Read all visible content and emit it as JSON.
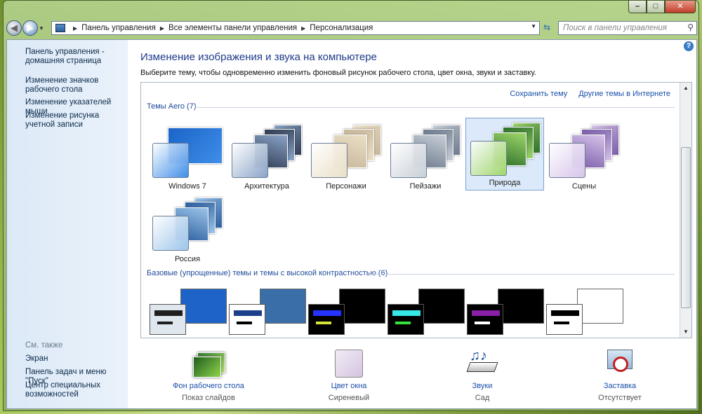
{
  "window": {
    "caption": {
      "minimize": "–",
      "maximize": "□",
      "close": "✕"
    }
  },
  "nav": {
    "back": "◀",
    "forward": "▶",
    "breadcrumbs": [
      "Панель управления",
      "Все элементы панели управления",
      "Персонализация"
    ],
    "search_placeholder": "Поиск в панели управления"
  },
  "sidebar": {
    "links": [
      {
        "label": "Панель управления - домашняя страница"
      },
      {
        "label": "Изменение значков рабочего стола"
      },
      {
        "label": "Изменение указателей мыши"
      },
      {
        "label": "Изменение рисунка учетной записи"
      }
    ],
    "see_also_header": "См. также",
    "see_also": [
      {
        "label": "Экран"
      },
      {
        "label": "Панель задач и меню \"Пуск\""
      },
      {
        "label": "Центр специальных возможностей"
      }
    ]
  },
  "main": {
    "title": "Изменение изображения и звука на компьютере",
    "description": "Выберите тему, чтобы одновременно изменить фоновый рисунок рабочего стола, цвет окна, звуки и заставку.",
    "save_theme": "Сохранить тему",
    "more_themes": "Другие темы в Интернете",
    "aero_group": "Темы Aero (7)",
    "aero_themes": [
      {
        "label": "Windows 7",
        "colors": [
          "#1a64c8",
          "#3f8ee8"
        ]
      },
      {
        "label": "Архитектура",
        "colors": [
          "#2f3c52",
          "#8aa4c8"
        ]
      },
      {
        "label": "Персонажи",
        "colors": [
          "#c7b79a",
          "#eadfc6"
        ]
      },
      {
        "label": "Пейзажи",
        "colors": [
          "#6c7a8c",
          "#c8cfd8"
        ]
      },
      {
        "label": "Природа",
        "colors": [
          "#2c6f2a",
          "#9fd66a"
        ],
        "selected": true
      },
      {
        "label": "Сцены",
        "colors": [
          "#7a5ca8",
          "#d6c4ea"
        ]
      },
      {
        "label": "Россия",
        "colors": [
          "#2b5e9e",
          "#9cc4ea"
        ]
      }
    ],
    "basic_group": "Базовые (упрощенные) темы и темы с высокой контрастностью (6)",
    "basic_themes": [
      {
        "bg": "#1e63c7",
        "win": "#dfe6ee",
        "bar1": "#1e1e1e",
        "bar2": "#1e1e1e"
      },
      {
        "bg": "#3a6ea8",
        "win": "#ffffff",
        "bar1": "#1b3f8a",
        "bar2": "#000000"
      },
      {
        "bg": "#000000",
        "win": "#000000",
        "bar1": "#2433ff",
        "bar2": "#d6e33a"
      },
      {
        "bg": "#000000",
        "win": "#000000",
        "bar1": "#37e8e8",
        "bar2": "#38e23a"
      },
      {
        "bg": "#000000",
        "win": "#000000",
        "bar1": "#8a1fa8",
        "bar2": "#ffffff"
      },
      {
        "bg": "#ffffff",
        "win": "#ffffff",
        "bar1": "#000000",
        "bar2": "#000000"
      }
    ],
    "bottom": [
      {
        "title": "Фон рабочего стола",
        "sub": "Показ слайдов",
        "icon": "wallpaper-icon"
      },
      {
        "title": "Цвет окна",
        "sub": "Сиреневый",
        "icon": "window-color-icon"
      },
      {
        "title": "Звуки",
        "sub": "Сад",
        "icon": "sounds-icon"
      },
      {
        "title": "Заставка",
        "sub": "Отсутствует",
        "icon": "screensaver-icon"
      }
    ]
  }
}
